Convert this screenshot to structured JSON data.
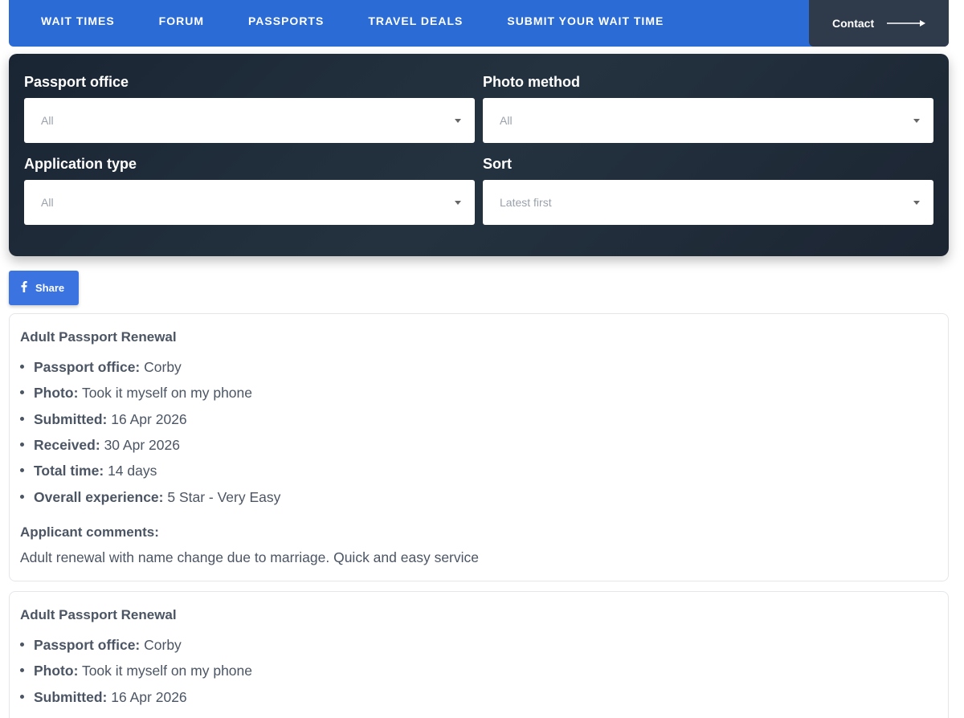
{
  "nav": {
    "links": [
      "WAIT TIMES",
      "FORUM",
      "PASSPORTS",
      "TRAVEL DEALS",
      "SUBMIT YOUR WAIT TIME"
    ],
    "contact_label": "Contact"
  },
  "filters": {
    "passport_office": {
      "label": "Passport office",
      "value": "All"
    },
    "photo_method": {
      "label": "Photo method",
      "value": "All"
    },
    "application_type": {
      "label": "Application type",
      "value": "All"
    },
    "sort": {
      "label": "Sort",
      "value": "Latest first"
    }
  },
  "share_label": "Share",
  "cards": [
    {
      "title": "Adult Passport Renewal",
      "details": [
        {
          "label": "Passport office:",
          "value": "Corby"
        },
        {
          "label": "Photo:",
          "value": "Took it myself on my phone"
        },
        {
          "label": "Submitted:",
          "value": "16 Apr 2026"
        },
        {
          "label": "Received:",
          "value": "30 Apr 2026"
        },
        {
          "label": "Total time:",
          "value": "14 days"
        },
        {
          "label": "Overall experience:",
          "value": "5 Star - Very Easy"
        }
      ],
      "comments_label": "Applicant comments:",
      "comments": "Adult renewal with name change due to marriage. Quick and easy service"
    },
    {
      "title": "Adult Passport Renewal",
      "details": [
        {
          "label": "Passport office:",
          "value": "Corby"
        },
        {
          "label": "Photo:",
          "value": "Took it myself on my phone"
        },
        {
          "label": "Submitted:",
          "value": "16 Apr 2026"
        }
      ]
    }
  ]
}
